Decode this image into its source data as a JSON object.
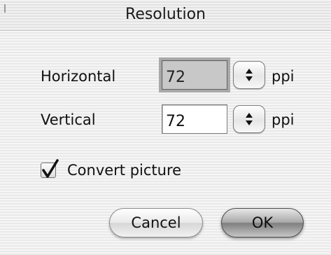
{
  "dialog": {
    "title": "Resolution"
  },
  "horizontal": {
    "label": "Horizontal",
    "value": "72",
    "unit": "ppi",
    "focused": true
  },
  "vertical": {
    "label": "Vertical",
    "value": "72",
    "unit": "ppi"
  },
  "convert": {
    "label": "Convert picture",
    "checked": true
  },
  "buttons": {
    "cancel": "Cancel",
    "ok": "OK",
    "default": "ok"
  },
  "icons": {
    "stepper": "up-down-arrows-icon",
    "check": "checkmark-icon"
  }
}
